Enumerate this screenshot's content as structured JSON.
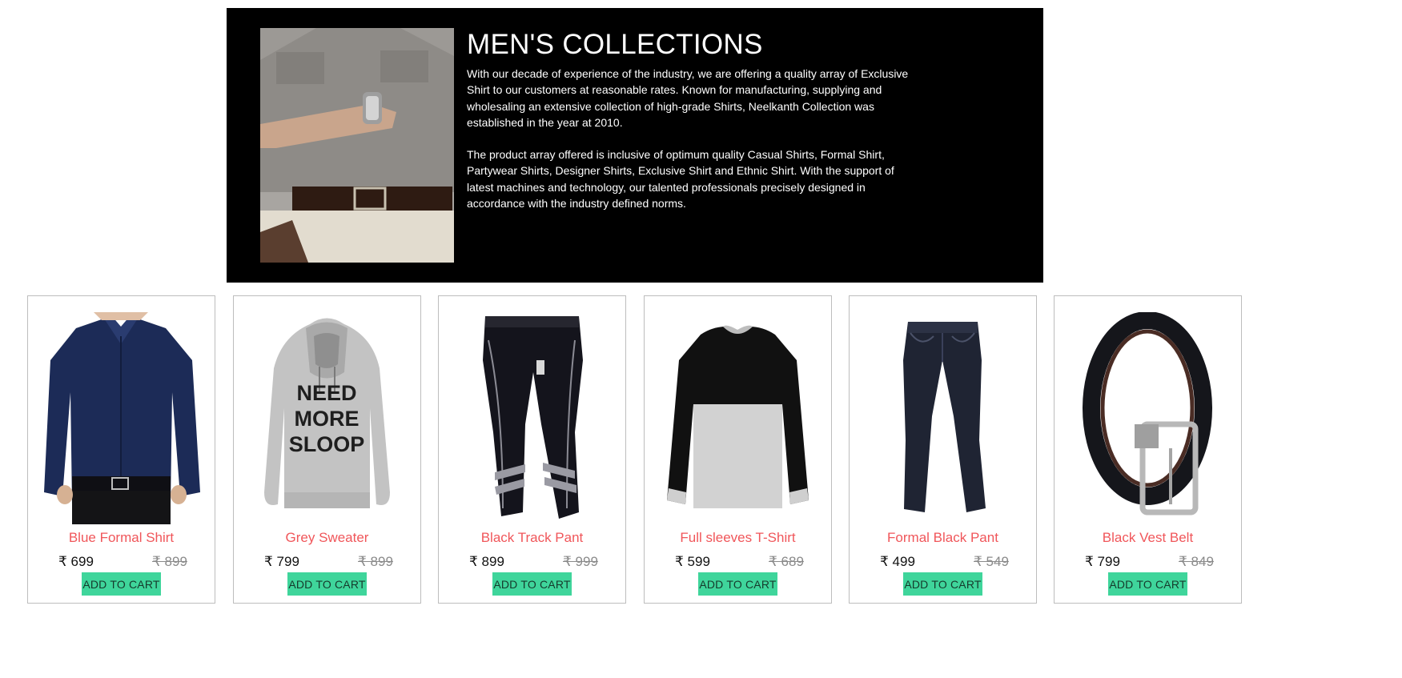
{
  "hero": {
    "title": "MEN'S COLLECTIONS",
    "paragraphs": [
      "With our decade of experience of the industry, we are offering a quality array of Exclusive Shirt to our customers at reasonable rates. Known for manufacturing, supplying and wholesaling an extensive collection of high-grade Shirts, Neelkanth Collection was established in the year at 2010.",
      "The product array offered is inclusive of optimum quality Casual Shirts, Formal Shirt, Partywear Shirts, Designer Shirts, Exclusive Shirt and Ethnic Shirt. With the support of latest machines and technology, our talented professionals precisely designed in accordance with the industry defined norms."
    ]
  },
  "products": [
    {
      "name": "Blue Formal Shirt",
      "price": "₹ 699",
      "old_price": "₹ 899",
      "button": "ADD TO CART"
    },
    {
      "name": "Grey Sweater",
      "price": "₹ 799",
      "old_price": "₹ 899",
      "button": "ADD TO CART",
      "print": [
        "NEED",
        "MORE",
        "SLOOP"
      ]
    },
    {
      "name": "Black Track Pant",
      "price": "₹ 899",
      "old_price": "₹ 999",
      "button": "ADD TO CART"
    },
    {
      "name": "Full sleeves T-Shirt",
      "price": "₹ 599",
      "old_price": "₹ 689",
      "button": "ADD TO CART"
    },
    {
      "name": "Formal Black Pant",
      "price": "₹ 499",
      "old_price": "₹ 549",
      "button": "ADD TO CART"
    },
    {
      "name": "Black Vest Belt",
      "price": "₹ 799",
      "old_price": "₹ 849",
      "button": "ADD TO CART"
    }
  ]
}
